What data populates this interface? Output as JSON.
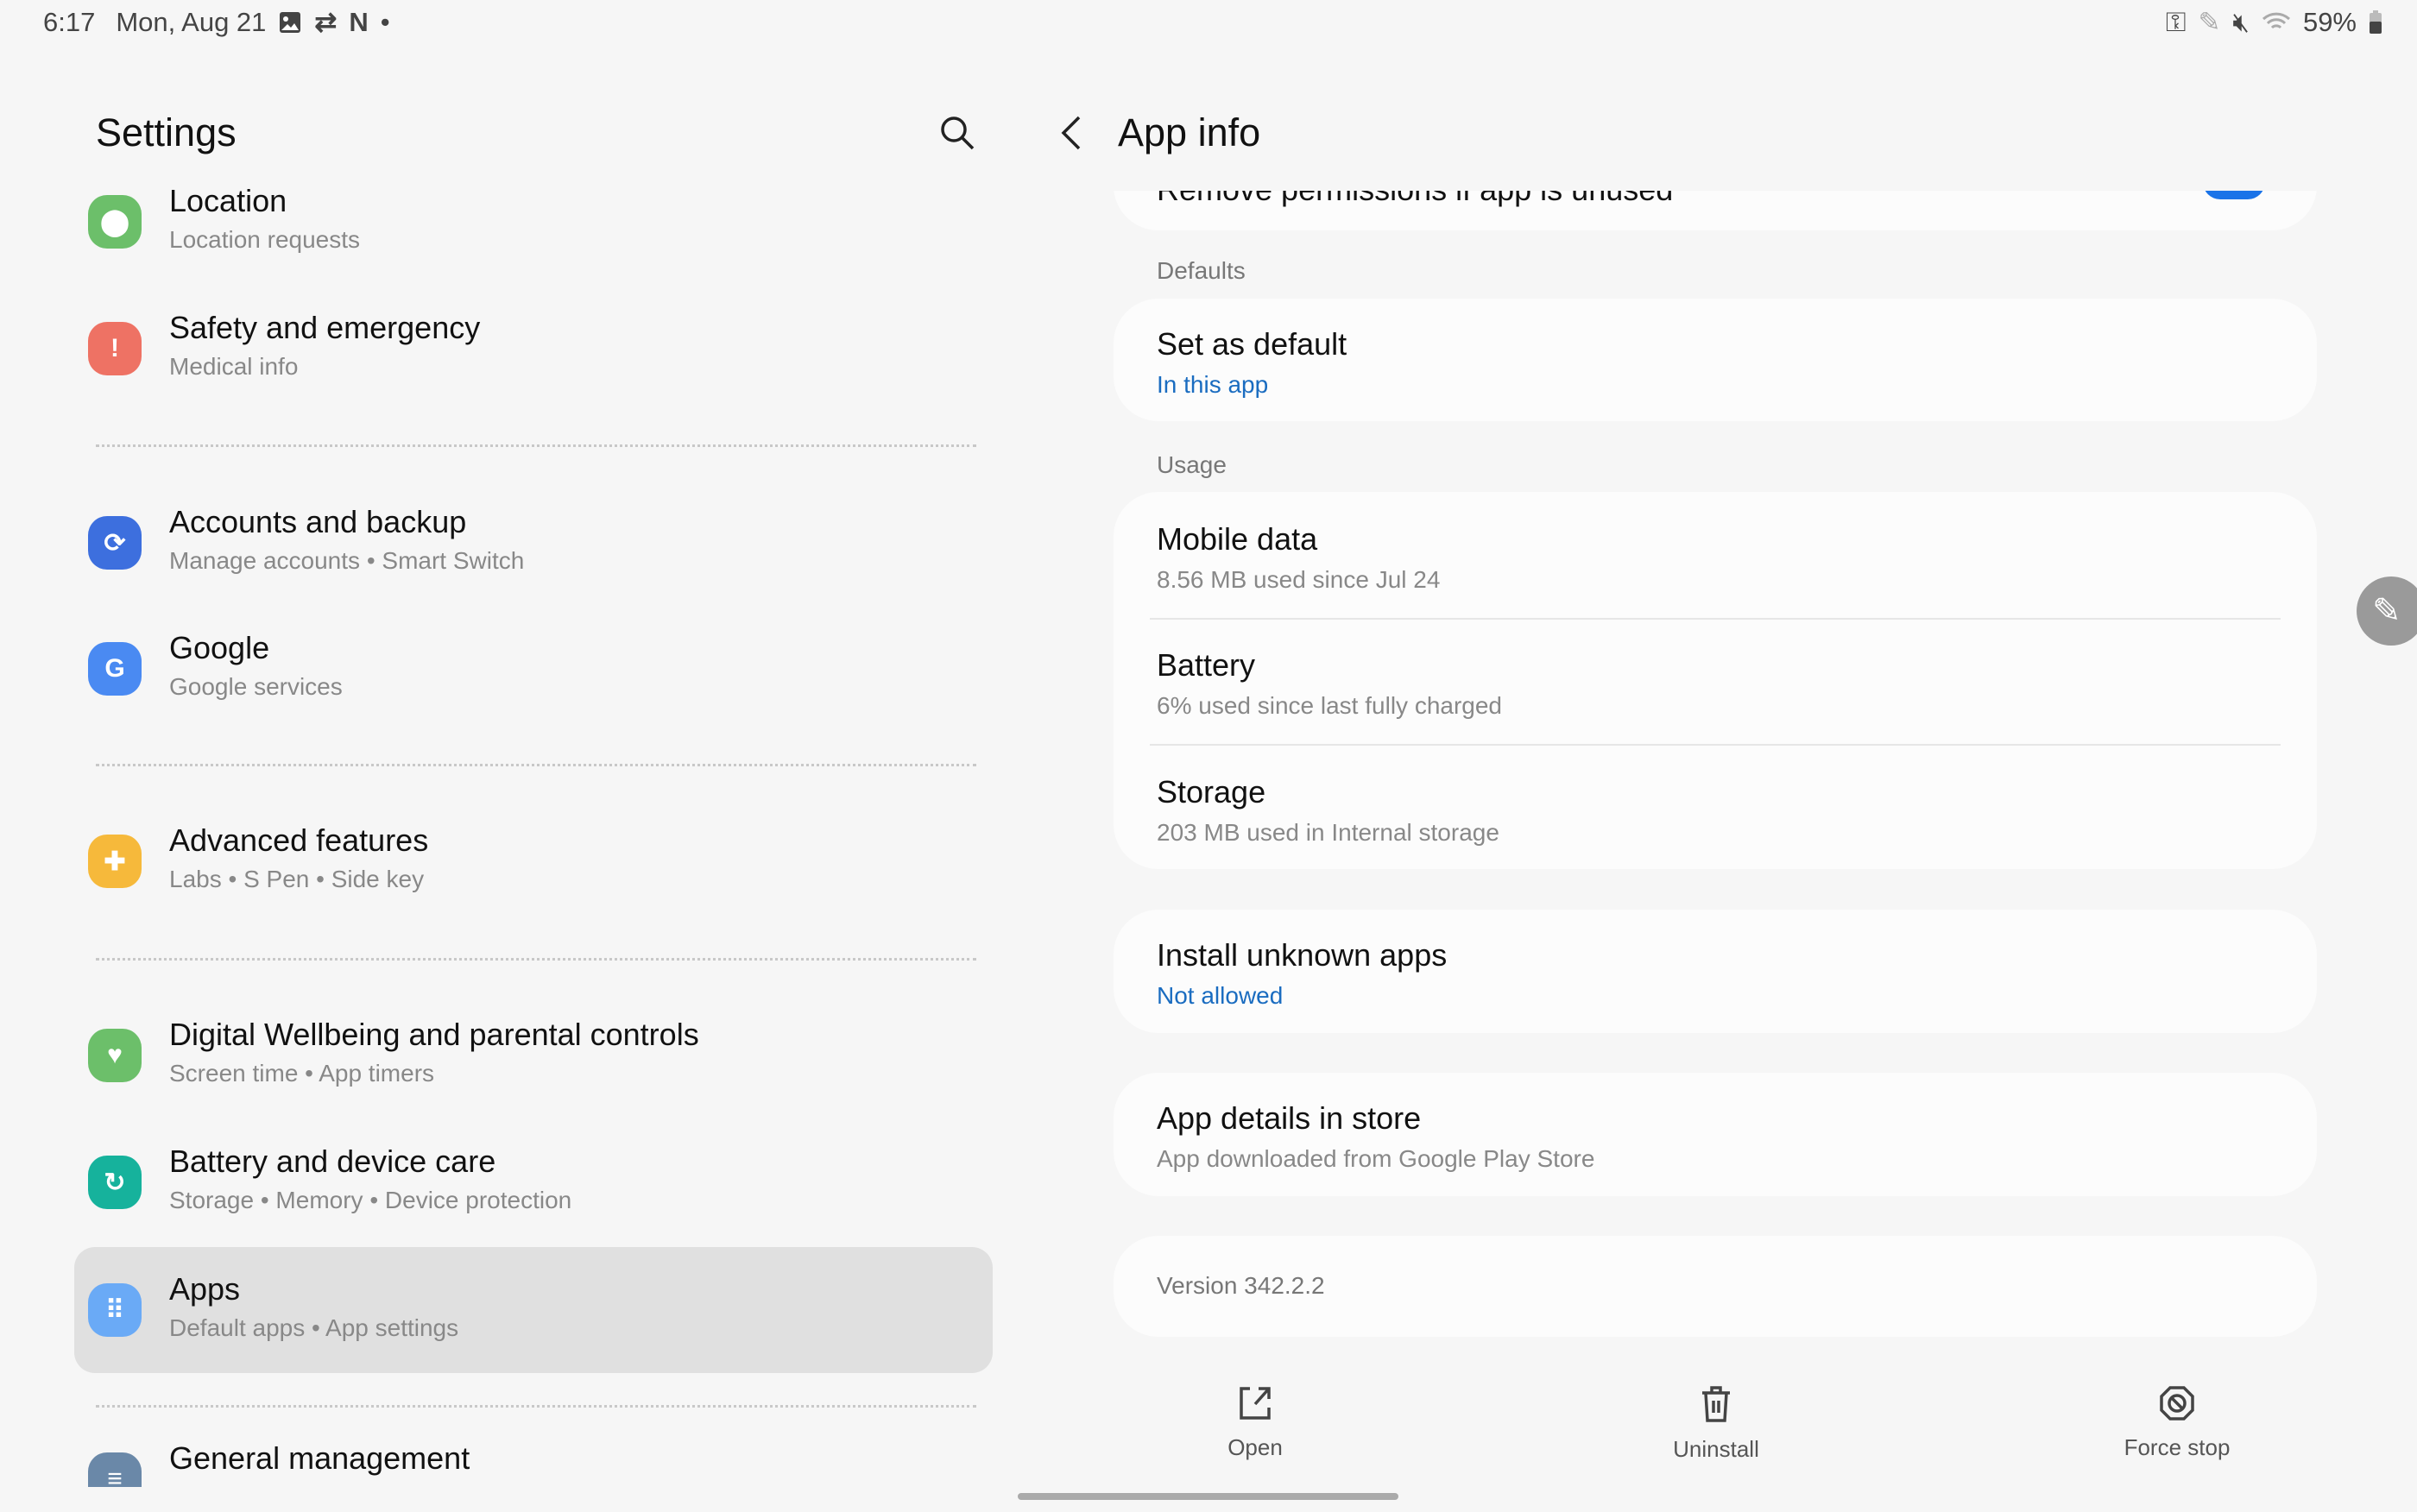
{
  "status_bar": {
    "time": "6:17",
    "date": "Mon, Aug 21",
    "battery": "59%",
    "left_icons": [
      "gallery-icon",
      "sync-icon",
      "netflix-icon",
      "dot-icon"
    ],
    "right_icons": [
      "vpn-key-icon",
      "pen-icon",
      "mute-icon",
      "wifi-icon",
      "battery-icon"
    ]
  },
  "left": {
    "title": "Settings",
    "items": [
      {
        "title": "Location",
        "subtitle": "Location requests",
        "color": "#6cbf6a",
        "icon": "location-icon"
      },
      {
        "title": "Safety and emergency",
        "subtitle": "Medical info",
        "color": "#ee7264",
        "icon": "siren-icon"
      },
      {
        "title": "Accounts and backup",
        "subtitle": "Manage accounts  •  Smart Switch",
        "color": "#3d6fde",
        "icon": "sync-icon"
      },
      {
        "title": "Google",
        "subtitle": "Google services",
        "color": "#4a8af2",
        "icon": "google-icon"
      },
      {
        "title": "Advanced features",
        "subtitle": "Labs  •  S Pen  •  Side key",
        "color": "#f6b93b",
        "icon": "gear-plus-icon"
      },
      {
        "title": "Digital Wellbeing and parental controls",
        "subtitle": "Screen time  •  App timers",
        "color": "#6cbf6a",
        "icon": "wellbeing-icon"
      },
      {
        "title": "Battery and device care",
        "subtitle": "Storage  •  Memory  •  Device protection",
        "color": "#16b29c",
        "icon": "device-care-icon"
      },
      {
        "title": "Apps",
        "subtitle": "Default apps  •  App settings",
        "color": "#6aaaf6",
        "icon": "apps-icon"
      },
      {
        "title": "General management",
        "color": "#6a88a8",
        "icon": "general-icon"
      }
    ]
  },
  "right": {
    "title": "App info",
    "clipped_row": "Remove permissions if app is unused",
    "defaults_label": "Defaults",
    "set_default": {
      "title": "Set as default",
      "subtitle": "In this app"
    },
    "usage_label": "Usage",
    "mobile_data": {
      "title": "Mobile data",
      "subtitle": "8.56 MB used since Jul 24"
    },
    "battery": {
      "title": "Battery",
      "subtitle": "6% used since last fully charged"
    },
    "storage": {
      "title": "Storage",
      "subtitle": "203 MB used in Internal storage"
    },
    "install_unknown": {
      "title": "Install unknown apps",
      "subtitle": "Not allowed"
    },
    "app_details": {
      "title": "App details in store",
      "subtitle": "App downloaded from Google Play Store"
    },
    "version": "Version 342.2.2",
    "actions": {
      "open": "Open",
      "uninstall": "Uninstall",
      "force_stop": "Force stop"
    }
  }
}
